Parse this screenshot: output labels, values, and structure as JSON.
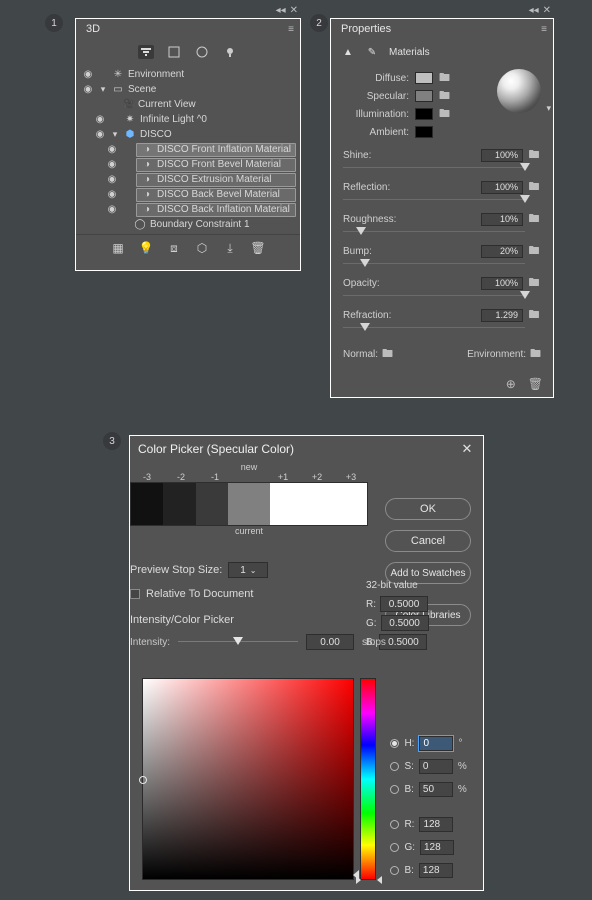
{
  "badges": {
    "one": "1",
    "two": "2",
    "three": "3"
  },
  "panel3d": {
    "tab": "3D",
    "tree": {
      "env": "Environment",
      "scene": "Scene",
      "currentView": "Current View",
      "light": "Infinite Light ^0",
      "disco": "DISCO",
      "mats": [
        "DISCO Front Inflation Material",
        "DISCO Front Bevel Material",
        "DISCO Extrusion Material",
        "DISCO Back Bevel Material",
        "DISCO Back Inflation Material"
      ],
      "boundary": "Boundary Constraint 1"
    }
  },
  "props": {
    "tab": "Properties",
    "section": "Materials",
    "diffuse": "Diffuse:",
    "specular": "Specular:",
    "illumination": "Illumination:",
    "ambient": "Ambient:",
    "sliders": {
      "shine": {
        "label": "Shine:",
        "value": "100%",
        "pos": 100
      },
      "reflection": {
        "label": "Reflection:",
        "value": "100%",
        "pos": 100
      },
      "roughness": {
        "label": "Roughness:",
        "value": "10%",
        "pos": 10
      },
      "bump": {
        "label": "Bump:",
        "value": "20%",
        "pos": 12
      },
      "opacity": {
        "label": "Opacity:",
        "value": "100%",
        "pos": 100
      },
      "refraction": {
        "label": "Refraction:",
        "value": "1.299",
        "pos": 12
      }
    },
    "normal": "Normal:",
    "environment": "Environment:"
  },
  "picker": {
    "title": "Color Picker (Specular Color)",
    "new": "new",
    "current": "current",
    "stops": [
      "-3",
      "-2",
      "-1",
      "",
      "+1",
      "+2",
      "+3"
    ],
    "ok": "OK",
    "cancel": "Cancel",
    "addSwatches": "Add to Swatches",
    "colorLibraries": "Color Libraries",
    "previewStop": "Preview Stop Size:",
    "previewStopVal": "1",
    "relative": "Relative To Document",
    "bit32": "32-bit value",
    "r": "R:",
    "g": "G:",
    "b": "B:",
    "rv": "0.5000",
    "gv": "0.5000",
    "bv": "0.5000",
    "intensitySection": "Intensity/Color Picker",
    "intensity": "Intensity:",
    "intensityVal": "0.00",
    "stopsUnit": "stops",
    "hsb": {
      "h": {
        "label": "H:",
        "val": "0",
        "unit": "°"
      },
      "s": {
        "label": "S:",
        "val": "0",
        "unit": "%"
      },
      "b": {
        "label": "B:",
        "val": "50",
        "unit": "%"
      },
      "r": {
        "label": "R:",
        "val": "128",
        "unit": ""
      },
      "g": {
        "label": "G:",
        "val": "128",
        "unit": ""
      },
      "b2": {
        "label": "B:",
        "val": "128",
        "unit": ""
      }
    }
  }
}
